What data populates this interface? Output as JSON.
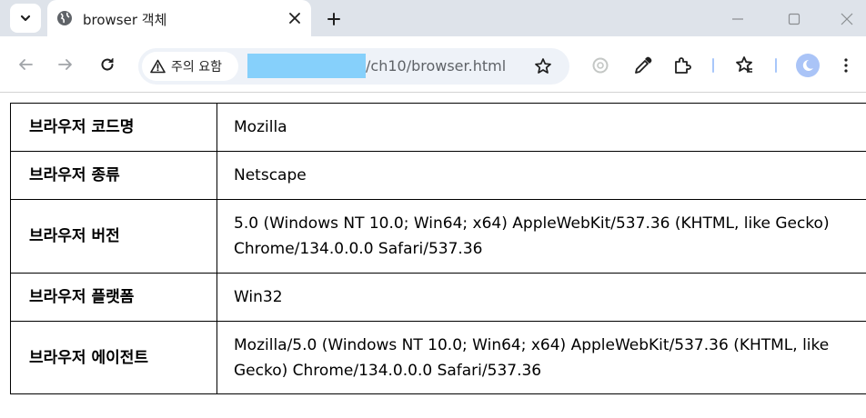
{
  "tab": {
    "title": "browser 객체"
  },
  "omnibox": {
    "security_label": "주의 요함",
    "url": "/ch10/browser.html"
  },
  "rows": [
    {
      "label": "브라우저 코드명",
      "value": "Mozilla"
    },
    {
      "label": "브라우저 종류",
      "value": "Netscape"
    },
    {
      "label": "브라우저 버전",
      "value": "5.0 (Windows NT 10.0; Win64; x64) AppleWebKit/537.36 (KHTML, like Gecko) Chrome/134.0.0.0 Safari/537.36"
    },
    {
      "label": "브라우저 플랫폼",
      "value": "Win32"
    },
    {
      "label": "브라우저 에이전트",
      "value": "Mozilla/5.0 (Windows NT 10.0; Win64; x64) AppleWebKit/537.36 (KHTML, like Gecko) Chrome/134.0.0.0 Safari/537.36"
    }
  ],
  "icons": {
    "tab_search": "chevron-down-icon",
    "favicon": "globe-icon",
    "tab_close": "close-icon",
    "new_tab": "plus-icon",
    "back": "arrow-left-icon",
    "forward": "arrow-right-icon",
    "reload": "reload-icon",
    "warning": "warning-icon",
    "bookmark": "star-icon",
    "eyedropper": "eyedropper-icon",
    "extensions": "puzzle-icon",
    "reading_list": "star-list-icon",
    "profile": "avatar-icon",
    "menu": "more-vertical-icon"
  },
  "colors": {
    "tabstrip": "#dee3ea",
    "omnibox": "#eef2f8",
    "redaction": "#86d0fb",
    "avatar": "#aac4f7"
  }
}
